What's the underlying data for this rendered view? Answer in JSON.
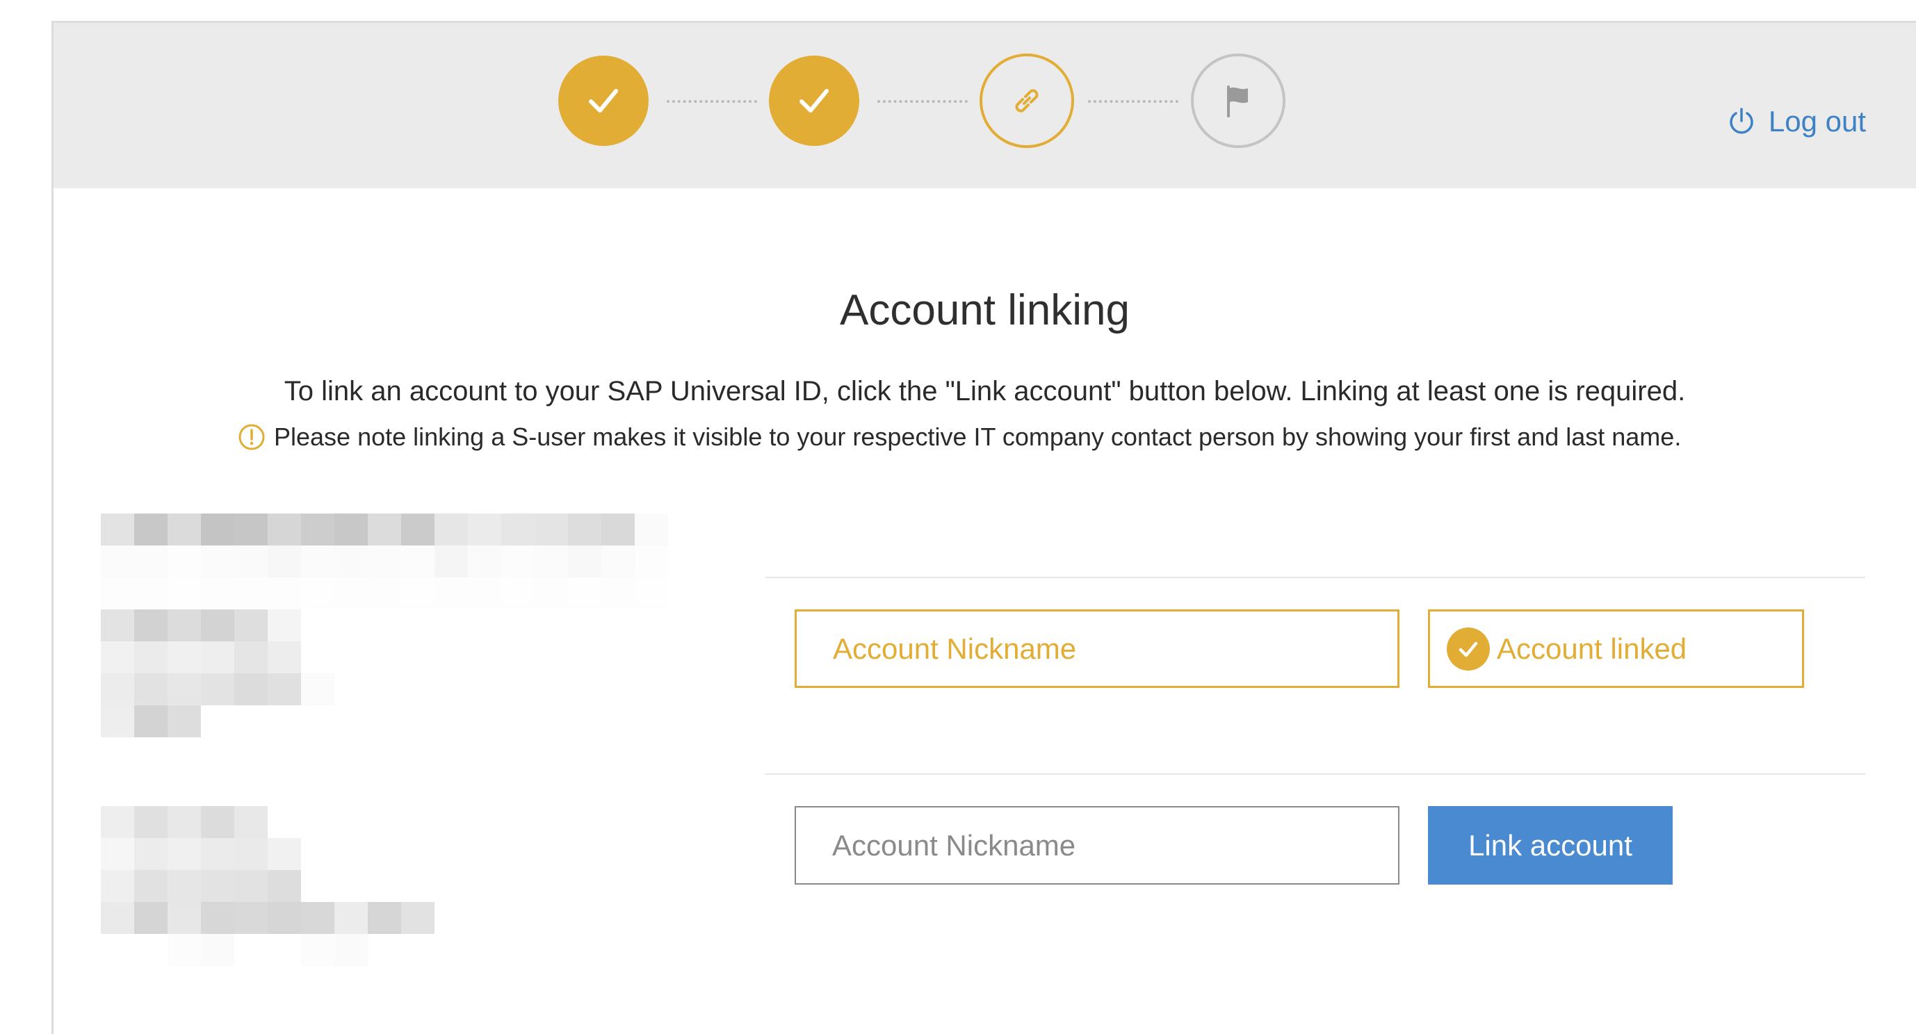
{
  "stepper": {
    "steps": [
      {
        "state": "done",
        "icon": "check-icon"
      },
      {
        "state": "done",
        "icon": "check-icon"
      },
      {
        "state": "current",
        "icon": "link-icon"
      },
      {
        "state": "future",
        "icon": "flag-icon"
      }
    ]
  },
  "header": {
    "logout_label": "Log out",
    "logout_icon": "power-icon"
  },
  "main": {
    "title": "Account linking",
    "intro": "To link an account to your SAP Universal ID, click the \"Link account\" button below. Linking at least one is required.",
    "note": "Please note linking a S-user makes it visible to your respective IT company contact person by showing your first and last name.",
    "note_icon": "warning-icon"
  },
  "accounts": [
    {
      "nickname_placeholder": "Account Nickname",
      "status_label": "Account linked",
      "status_icon": "check-circle-icon"
    },
    {
      "nickname_placeholder": "Account Nickname",
      "action_label": "Link account"
    }
  ],
  "colors": {
    "accent": "#e2ad35",
    "primary_button": "#4a8ad0",
    "link": "#3d82c4",
    "header_bg": "#ebebeb"
  }
}
